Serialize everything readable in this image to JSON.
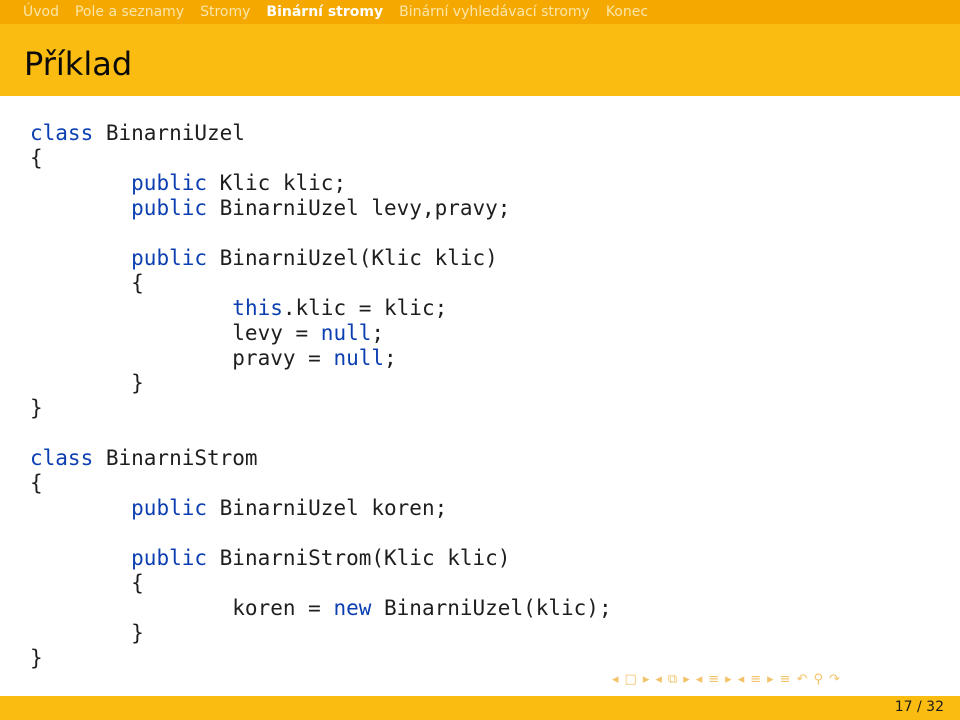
{
  "nav": {
    "items": [
      "Úvod",
      "Pole a seznamy",
      "Stromy",
      "Binární stromy",
      "Binární vyhledávací stromy",
      "Konec"
    ],
    "active_index": 3
  },
  "frame": {
    "title": "Příklad"
  },
  "code": {
    "lines": [
      [
        {
          "t": "kw",
          "s": "class"
        },
        {
          "t": "tx",
          "s": " BinarniUzel"
        }
      ],
      [
        {
          "t": "tx",
          "s": "{"
        }
      ],
      [
        {
          "t": "tx",
          "s": "        "
        },
        {
          "t": "kw",
          "s": "public"
        },
        {
          "t": "tx",
          "s": " Klic klic;"
        }
      ],
      [
        {
          "t": "tx",
          "s": "        "
        },
        {
          "t": "kw",
          "s": "public"
        },
        {
          "t": "tx",
          "s": " BinarniUzel levy,pravy;"
        }
      ],
      [],
      [
        {
          "t": "tx",
          "s": "        "
        },
        {
          "t": "kw",
          "s": "public"
        },
        {
          "t": "tx",
          "s": " BinarniUzel(Klic klic)"
        }
      ],
      [
        {
          "t": "tx",
          "s": "        {"
        }
      ],
      [
        {
          "t": "tx",
          "s": "                "
        },
        {
          "t": "kw",
          "s": "this"
        },
        {
          "t": "tx",
          "s": ".klic = klic;"
        }
      ],
      [
        {
          "t": "tx",
          "s": "                levy = "
        },
        {
          "t": "kw",
          "s": "null"
        },
        {
          "t": "tx",
          "s": ";"
        }
      ],
      [
        {
          "t": "tx",
          "s": "                pravy = "
        },
        {
          "t": "kw",
          "s": "null"
        },
        {
          "t": "tx",
          "s": ";"
        }
      ],
      [
        {
          "t": "tx",
          "s": "        }"
        }
      ],
      [
        {
          "t": "tx",
          "s": "}"
        }
      ],
      [],
      [
        {
          "t": "kw",
          "s": "class"
        },
        {
          "t": "tx",
          "s": " BinarniStrom"
        }
      ],
      [
        {
          "t": "tx",
          "s": "{"
        }
      ],
      [
        {
          "t": "tx",
          "s": "        "
        },
        {
          "t": "kw",
          "s": "public"
        },
        {
          "t": "tx",
          "s": " BinarniUzel koren;"
        }
      ],
      [],
      [
        {
          "t": "tx",
          "s": "        "
        },
        {
          "t": "kw",
          "s": "public"
        },
        {
          "t": "tx",
          "s": " BinarniStrom(Klic klic)"
        }
      ],
      [
        {
          "t": "tx",
          "s": "        {"
        }
      ],
      [
        {
          "t": "tx",
          "s": "                koren = "
        },
        {
          "t": "kw",
          "s": "new"
        },
        {
          "t": "tx",
          "s": " BinarniUzel(klic);"
        }
      ],
      [
        {
          "t": "tx",
          "s": "        }"
        }
      ],
      [
        {
          "t": "tx",
          "s": "}"
        }
      ]
    ]
  },
  "footer": {
    "page": "17 / 32"
  },
  "nav_symbols": [
    {
      "name": "prev-frame-icon",
      "glyph": "◂"
    },
    {
      "name": "frame-icon",
      "glyph": "□"
    },
    {
      "name": "next-frame-icon",
      "glyph": "▸"
    },
    {
      "name": "prev-subsection-icon",
      "glyph": "◂"
    },
    {
      "name": "subsection-icon",
      "glyph": "⧉"
    },
    {
      "name": "next-subsection-icon",
      "glyph": "▸"
    },
    {
      "name": "prev-section-icon",
      "glyph": "◂"
    },
    {
      "name": "section-icon",
      "glyph": "≡"
    },
    {
      "name": "next-section-icon",
      "glyph": "▸"
    },
    {
      "name": "prev-chapter-icon",
      "glyph": "◂"
    },
    {
      "name": "chapter-icon",
      "glyph": "≡"
    },
    {
      "name": "next-chapter-icon",
      "glyph": "▸"
    },
    {
      "name": "presentation-icon",
      "glyph": "≡"
    },
    {
      "name": "undo-icon",
      "glyph": "↶"
    },
    {
      "name": "search-icon",
      "glyph": "⚲"
    },
    {
      "name": "redo-icon",
      "glyph": "↷"
    }
  ],
  "colors": {
    "navbar": "#f5a800",
    "title_bar": "#fbbc11",
    "keyword": "#0b3fb1"
  }
}
